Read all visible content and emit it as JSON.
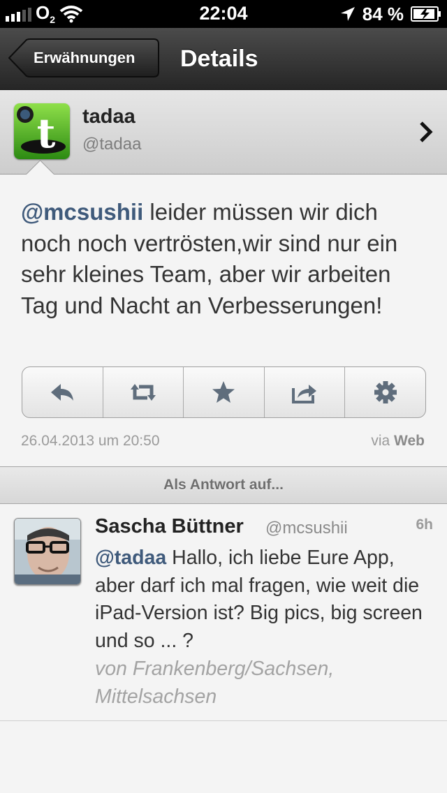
{
  "status_bar": {
    "carrier": "O",
    "carrier_sub": "2",
    "time": "22:04",
    "battery_percent": "84 %",
    "signal_bars": 5,
    "signal_bars_filled": 3
  },
  "nav": {
    "back_label": "Erwähnungen",
    "title": "Details"
  },
  "profile": {
    "name": "tadaa",
    "handle": "@tadaa",
    "avatar_letter": "t"
  },
  "tweet": {
    "mention": "@mcsushii",
    "text": " leider müssen wir dich noch noch vertrösten,wir sind nur ein sehr kleines Team, aber wir arbeiten Tag und Nacht an Verbesserungen!",
    "timestamp": "26.04.2013 um 20:50",
    "via_prefix": "via ",
    "via_source": "Web"
  },
  "actions": [
    {
      "name": "reply",
      "icon": "reply-icon"
    },
    {
      "name": "retweet",
      "icon": "retweet-icon"
    },
    {
      "name": "favorite",
      "icon": "star-icon"
    },
    {
      "name": "share",
      "icon": "share-icon"
    },
    {
      "name": "settings",
      "icon": "gear-icon"
    }
  ],
  "in_reply_to": {
    "header": "Als Antwort auf...",
    "name": "Sascha Büttner",
    "handle": "@mcsushii",
    "time": "6h",
    "mention": "@tadaa",
    "text": " Hallo, ich liebe Eure App, aber darf ich mal fragen, wie weit die iPad-Version ist? Big pics, big screen und so ... ?",
    "location": "von Frankenberg/Sachsen, Mittelsachsen"
  },
  "colors": {
    "link": "#3f5a7b",
    "nav_bar": "#333333",
    "background": "#f4f4f4"
  }
}
